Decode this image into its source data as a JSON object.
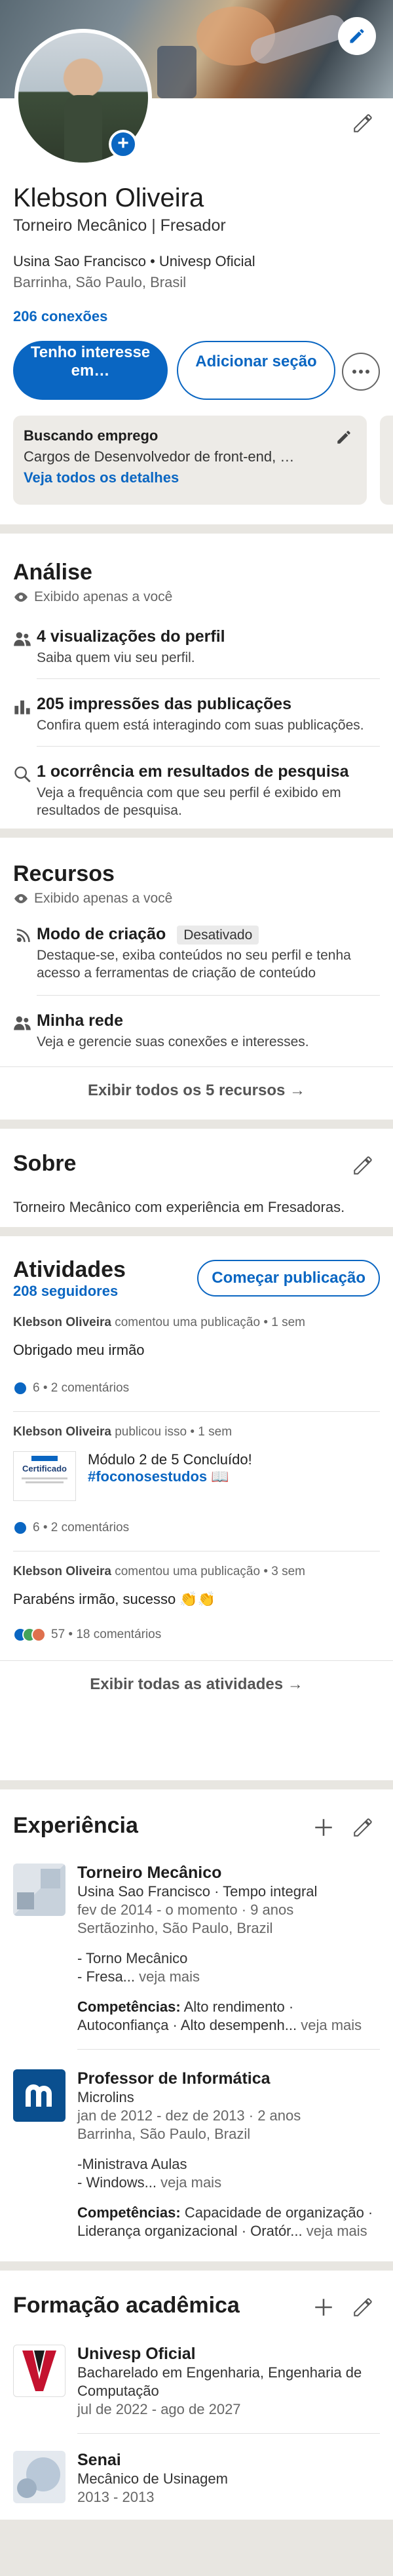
{
  "profile": {
    "name": "Klebson Oliveira",
    "headline": "Torneiro Mecânico  |  Fresador",
    "company_line": "Usina Sao Francisco • Univesp Oficial",
    "location": "Barrinha, São Paulo, Brasil",
    "connections": "206 conexões",
    "primary_button": "Tenho interesse em…",
    "secondary_button": "Adicionar seção",
    "open_to_work": {
      "title": "Buscando emprego",
      "roles": "Cargos de Desenvolvedor de front-end, …",
      "details_link": "Veja todos os detalhes"
    }
  },
  "analytics": {
    "title": "Análise",
    "visibility": "Exibido apenas a você",
    "items": [
      {
        "title": "4 visualizações do perfil",
        "subtitle": "Saiba quem viu seu perfil.",
        "icon": "people-icon"
      },
      {
        "title": "205 impressões das publicações",
        "subtitle": "Confira quem está interagindo com suas publicações.",
        "icon": "bar-chart-icon"
      },
      {
        "title": "1 ocorrência em resultados de pesquisa",
        "subtitle": "Veja a frequência com que seu perfil é exibido em resultados de pesquisa.",
        "icon": "search-icon"
      }
    ]
  },
  "resources": {
    "title": "Recursos",
    "visibility": "Exibido apenas a você",
    "creator_mode": {
      "title": "Modo de criação",
      "badge": "Desativado",
      "subtitle": "Destaque-se, exiba conteúdos no seu perfil e tenha acesso a ferramentas de criação de conteúdo"
    },
    "network": {
      "title": "Minha rede",
      "subtitle": "Veja e gerencie suas conexões e interesses."
    },
    "show_all": "Exibir todos os 5 recursos →"
  },
  "about": {
    "title": "Sobre",
    "text": "Torneiro Mecânico com experiência em Fresadoras."
  },
  "activity": {
    "title": "Atividades",
    "followers": "208 seguidores",
    "start_post": "Começar publicação",
    "posts": [
      {
        "author": "Klebson Oliveira",
        "meta": " comentou uma publicação • 1 sem",
        "text": "Obrigado meu irmão",
        "reactions": "6 •  2 comentários"
      },
      {
        "author": "Klebson Oliveira",
        "meta": " publicou isso • 1 sem",
        "text": "Módulo 2 de 5 Concluído!",
        "hashtag": "#foconosestudos",
        "thumb_label": "Certificado",
        "reactions": "6 •  2 comentários"
      },
      {
        "author": "Klebson Oliveira",
        "meta": " comentou uma publicação • 3 sem",
        "text": "Parabéns irmão, sucesso 👏👏",
        "reactions": "57 •  18 comentários"
      }
    ],
    "show_all": "Exibir todas as atividades →"
  },
  "experience": {
    "title": "Experiência",
    "items": [
      {
        "title": "Torneiro  Mecânico",
        "company": "Usina Sao Francisco · Tempo integral",
        "dates": "fev de 2014 - o momento · 9 anos",
        "location": "Sertãozinho, São Paulo, Brazil",
        "desc1": "- Torno Mecânico",
        "desc2": "- Fresa...",
        "desc_more": " veja mais",
        "skills_label": "Competências:",
        "skills": " Alto rendimento · Autoconfiança · Alto desempenh...",
        "skills_more": " veja mais"
      },
      {
        "title": "Professor de Informática",
        "company": "Microlins",
        "dates": "jan de 2012 - dez de 2013 · 2 anos",
        "location": "Barrinha, São Paulo, Brazil",
        "desc1": "-Ministrava Aulas",
        "desc2": "- Windows...",
        "desc_more": " veja mais",
        "skills_label": "Competências:",
        "skills": " Capacidade de organização · Liderança organizacional · Oratór...",
        "skills_more": " veja mais"
      }
    ]
  },
  "education": {
    "title": "Formação acadêmica",
    "items": [
      {
        "school": "Univesp Oficial",
        "degree": "Bacharelado em Engenharia, Engenharia de Computação",
        "dates": "jul de 2022 - ago de 2027"
      },
      {
        "school": "Senai",
        "degree": "Mecânico de Usinagem",
        "dates": "2013 - 2013"
      }
    ]
  },
  "colors": {
    "accent": "#0a66c2",
    "background": "#e8e6e1"
  }
}
